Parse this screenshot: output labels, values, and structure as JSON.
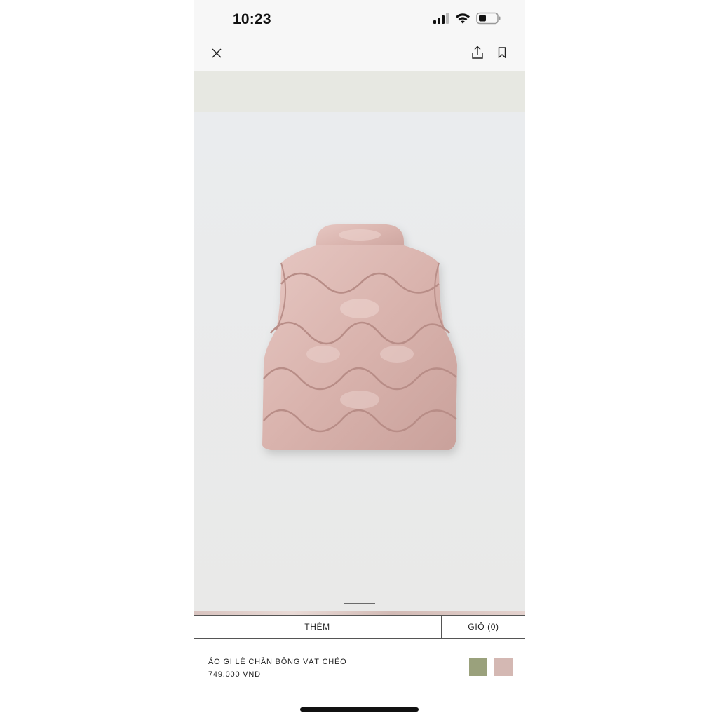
{
  "status_bar": {
    "time": "10:23",
    "icons": [
      "signal-icon",
      "wifi-icon",
      "battery-icon"
    ]
  },
  "toolbar": {
    "close_icon": "close-icon",
    "share_icon": "share-icon",
    "bookmark_icon": "bookmark-icon"
  },
  "product_image": {
    "description_icon": "product-photo"
  },
  "actions": {
    "add_label": "THÊM",
    "cart_label": "GIỎ (0)"
  },
  "product": {
    "name": "ÁO GI LÊ CHẦN BÔNG VẠT CHÉO",
    "price": "749.000 VND"
  },
  "swatches": {
    "colors": [
      "#9aa17c",
      "#d4b8b3"
    ],
    "selected_index": 1
  }
}
